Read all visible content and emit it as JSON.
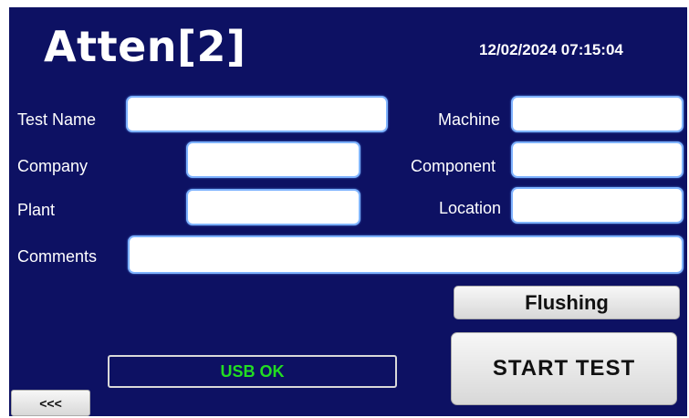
{
  "header": {
    "logo_text": "Atten[2]",
    "datetime": "12/02/2024 07:15:04"
  },
  "form": {
    "test_name": {
      "label": "Test Name",
      "value": ""
    },
    "company": {
      "label": "Company",
      "value": ""
    },
    "plant": {
      "label": "Plant",
      "value": ""
    },
    "comments": {
      "label": "Comments",
      "value": ""
    },
    "machine": {
      "label": "Machine",
      "value": ""
    },
    "component": {
      "label": "Component",
      "value": ""
    },
    "location": {
      "label": "Location",
      "value": ""
    }
  },
  "buttons": {
    "flushing": "Flushing",
    "start_test": "START TEST",
    "back": "<<<"
  },
  "status": {
    "text": "USB OK",
    "color": "#22dd22"
  },
  "colors": {
    "background": "#0d1163",
    "field_border": "#7fb3ff"
  }
}
